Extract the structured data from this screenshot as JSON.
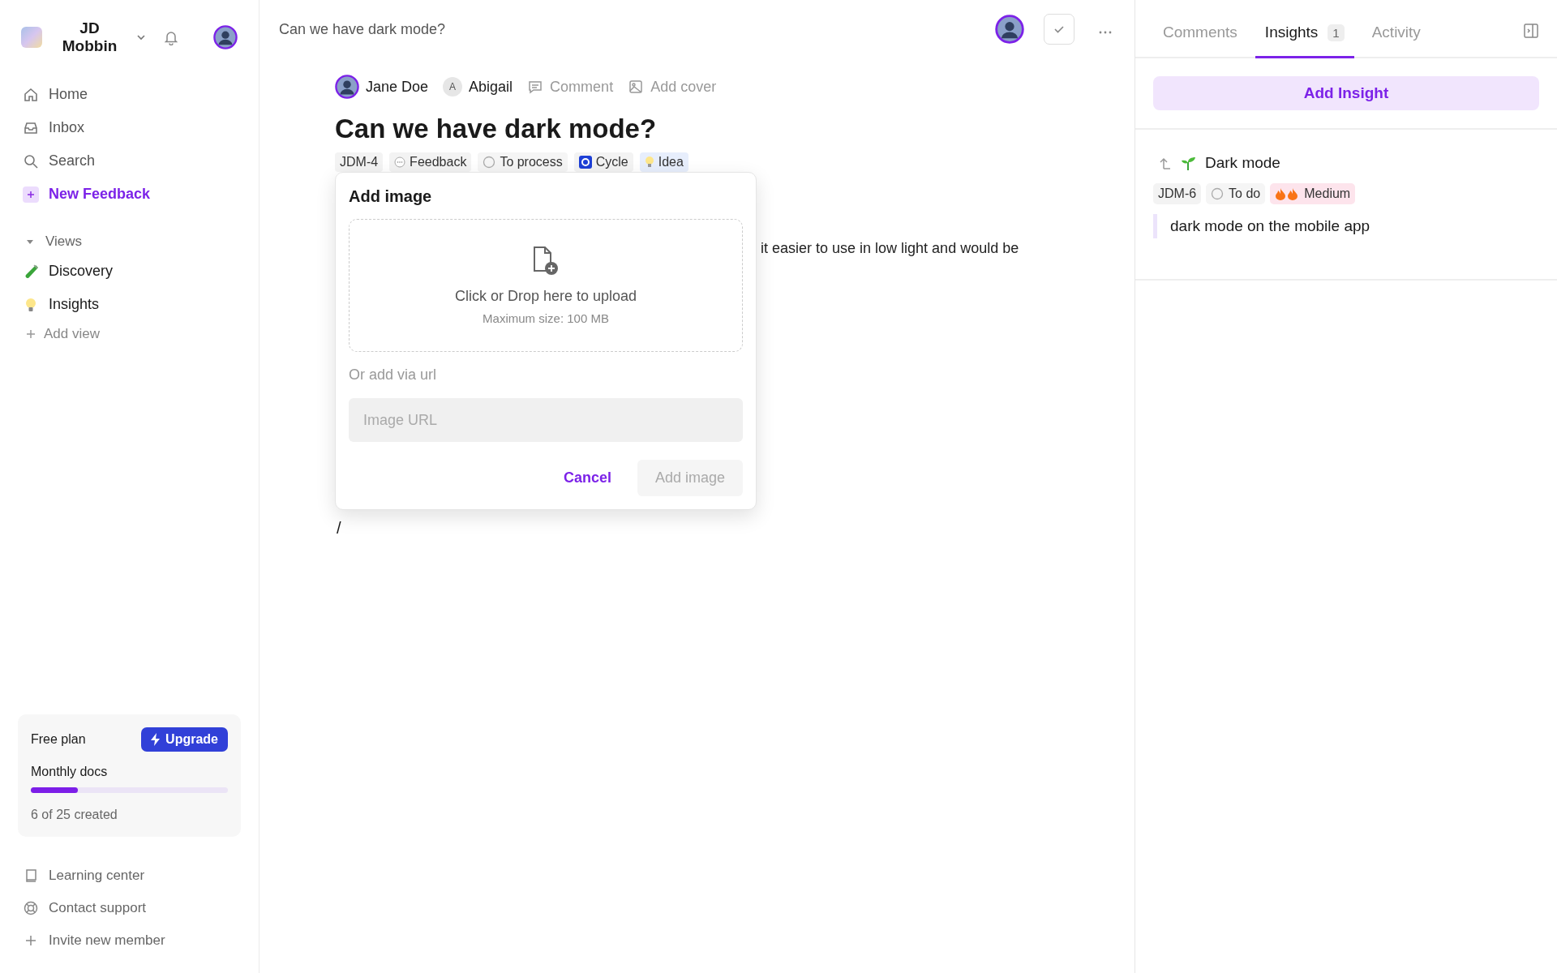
{
  "workspace": {
    "name": "JD Mobbin"
  },
  "nav": [
    {
      "label": "Home",
      "kind": "home",
      "selected": false
    },
    {
      "label": "Inbox",
      "kind": "inbox",
      "selected": false
    },
    {
      "label": "Search",
      "kind": "search",
      "selected": false
    },
    {
      "label": "New Feedback",
      "kind": "new",
      "selected": false
    }
  ],
  "views": {
    "title": "Views",
    "expanded": true,
    "items": [
      {
        "label": "Discovery",
        "kind": "testtube"
      },
      {
        "label": "Insights",
        "kind": "bulb"
      }
    ],
    "add_label": "Add view"
  },
  "plan": {
    "name": "Free plan",
    "upgrade": "Upgrade",
    "meter_label": "Monthly docs",
    "level": 0.24,
    "reading": "6 of 25 created"
  },
  "footer_links": [
    {
      "label": "Learning center",
      "kind": "book"
    },
    {
      "label": "Contact support",
      "kind": "support"
    },
    {
      "label": "Invite new member",
      "kind": "plus"
    }
  ],
  "header": {
    "title": "Can we have dark mode?"
  },
  "doc": {
    "author": "Jane Doe",
    "assignee_initial": "A",
    "assignee": "Abigail",
    "actions": [
      {
        "label": "Comment",
        "kind": "comment"
      },
      {
        "label": "Add cover",
        "kind": "image"
      }
    ],
    "title": "Can we have dark mode?",
    "tags": [
      {
        "label": "JDM-4",
        "kind": "id"
      },
      {
        "label": "Feedback",
        "kind": "feedback"
      },
      {
        "label": "To process",
        "kind": "status"
      },
      {
        "label": "Cycle",
        "kind": "cycle"
      },
      {
        "label": "Idea",
        "kind": "idea"
      }
    ],
    "body": "it easier to use in low light and would be",
    "slash": "/"
  },
  "modal": {
    "title": "Add image",
    "upload_text": "Click or Drop here to upload",
    "upload_hint": "Maximum size: 100 MB",
    "url_label": "Or add via url",
    "placeholder": "Image URL",
    "cancel": "Cancel",
    "submit": "Add image",
    "submit_disabled": true
  },
  "panel": {
    "tabs": [
      {
        "label": "Comments",
        "selected": false
      },
      {
        "label": "Insights",
        "selected": true,
        "count": "1"
      },
      {
        "label": "Activity",
        "selected": false
      }
    ],
    "add_button": "Add Insight",
    "insight": {
      "title": "Dark mode",
      "tags": [
        {
          "label": "JDM-6",
          "kind": "id"
        },
        {
          "label": "To do",
          "kind": "status"
        },
        {
          "label": "Medium",
          "kind": "priority"
        }
      ],
      "quote": "dark mode on the mobile app"
    }
  }
}
